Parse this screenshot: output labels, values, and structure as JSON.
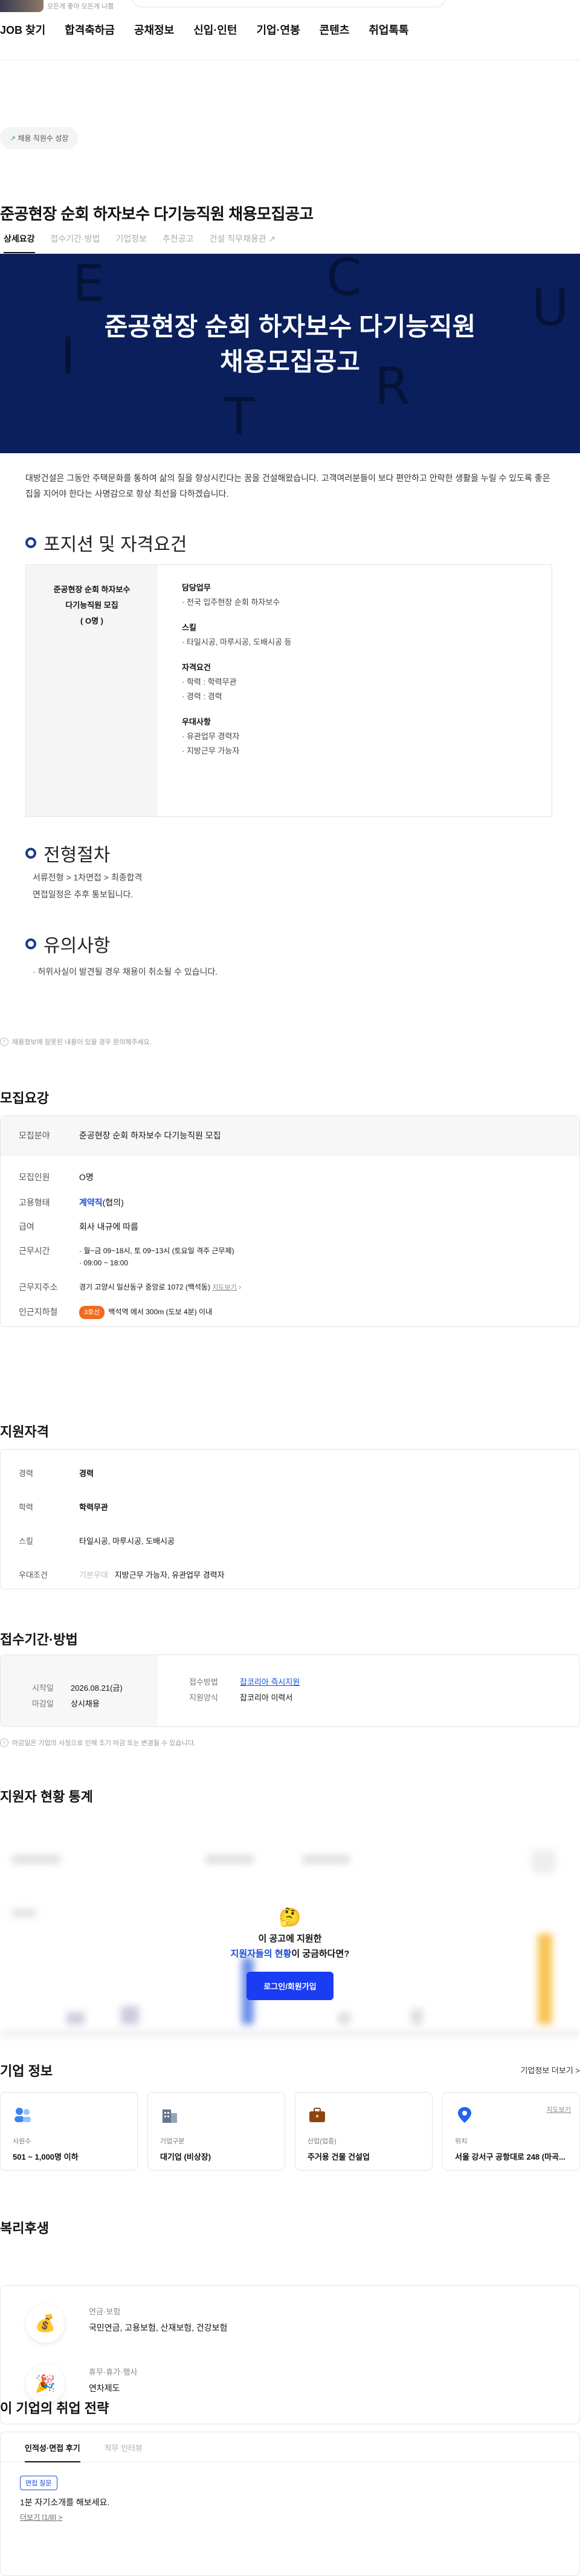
{
  "header": {
    "logo_caption": "모든게 좋아 모든게 나쁨",
    "nav": [
      "JOB 찾기",
      "합격축하금",
      "공채정보",
      "신입·인턴",
      "기업·연봉",
      "콘텐츠",
      "취업톡톡"
    ]
  },
  "badge": {
    "label": "채용 직원수 성장"
  },
  "job": {
    "title": "준공현장 순회 하자보수 다기능직원 채용모집공고",
    "tabs": [
      "상세요강",
      "접수기간·방법",
      "기업정보",
      "추천공고",
      "건설 직무채용관"
    ],
    "banner_title_line1": "준공현장 순회 하자보수 다기능직원",
    "banner_title_line2": "채용모집공고",
    "banner_letters": [
      "E",
      "C",
      "I",
      "R",
      "U",
      "T"
    ],
    "intro": "대방건설은 그동안 주택문화를 통하여 삶의 질을 향상시킨다는 꿈을 건설해왔습니다. 고객여러분들이 보다 편안하고 안락한 생활을 누릴 수 있도록 좋은 집을 지어야 한다는 사명감으로 항상 최선을 다하겠습니다."
  },
  "positions": {
    "heading": "포지션 및 자격요건",
    "left_title": "준공현장 순회 하자보수 다기능직원 모집",
    "left_count": "( O명 )",
    "duties_label": "담당업무",
    "duties": "· 전국 입주현장 순회 하자보수",
    "skills_label": "스킬",
    "skills": "· 타일시공, 마루시공, 도배시공 등",
    "req_label": "자격요건",
    "req": [
      "· 학력 : 학력무관",
      "· 경력 : 경력"
    ],
    "pref_label": "우대사항",
    "pref": [
      "· 유관업무 경력자",
      "· 지방근무 가능자"
    ]
  },
  "process": {
    "heading": "전형절차",
    "steps": "서류전형 > 1차면접 > 최종합격",
    "note": "면접일정은 추후 통보됩니다."
  },
  "caution": {
    "heading": "유의사항",
    "text": "· 허위사실이 발견될 경우 채용이 취소될 수 있습니다."
  },
  "report_note": "채용정보에 잘못된 내용이 있을 경우 문의해주세요.",
  "summary": {
    "heading": "모집요강",
    "field_label": "모집분야",
    "field": "준공현장 순회 하자보수 다기능직원 모집",
    "count_label": "모집인원",
    "count": "O명",
    "type_label": "고용형태",
    "type_value": "계약직",
    "type_suffix": "(협의)",
    "pay_label": "급여",
    "pay": "회사 내규에 따름",
    "hours_label": "근무시간",
    "hours1": "· 월~금 09~18시, 토 09~13시 (토요일 격주 근무제)",
    "hours2": "· 09:00 ~ 18:00",
    "addr_label": "근무지주소",
    "addr": "경기 고양시 일산동구 중앙로 1072 (백석동)",
    "addr_link": "지도보기",
    "subway_label": "인근지하철",
    "subway_line": "3호선",
    "subway": "백석역 에서 300m (도보 4분) 이내"
  },
  "qual": {
    "heading": "지원자격",
    "exp_label": "경력",
    "exp": "경력",
    "edu_label": "학력",
    "edu": "학력무관",
    "skill_label": "스킬",
    "skill": "타일시공, 마루시공, 도배시공",
    "pref_label": "우대조건",
    "pref_tag": "기본우대",
    "pref": "지방근무 가능자, 유관업무 경력자"
  },
  "apply": {
    "heading": "접수기간·방법",
    "start_label": "시작일",
    "start": "2026.08.21(금)",
    "end_label": "마감일",
    "end": "상시채용",
    "method_label": "접수방법",
    "method": "잡코리아 즉시지원",
    "form_label": "지원양식",
    "form": "잡코리아 이력서",
    "note": "마감일은 기업의 사정으로 인해 조기 마감 또는 변경될 수 있습니다."
  },
  "stats": {
    "heading": "지원자 현황 통계",
    "emoji": "🤔",
    "line1": "이 공고에 지원한",
    "line2_blue": "지원자들의 현황",
    "line2_rest": "이 궁금하다면?",
    "button": "로그인/회원가입"
  },
  "company": {
    "heading": "기업 정보",
    "more": "기업정보 더보기 >",
    "cards": [
      {
        "icon": "people-icon",
        "label": "사원수",
        "value": "501 ~ 1,000명 이하"
      },
      {
        "icon": "building-icon",
        "label": "기업구분",
        "value": "대기업 (비상장)"
      },
      {
        "icon": "briefcase-icon",
        "label": "산업(업종)",
        "value": "주거용 건물 건설업"
      },
      {
        "icon": "location-pin-icon",
        "label": "위치",
        "value": "서울 강서구 공항대로 248 (마곡...",
        "map": "지도보기"
      }
    ]
  },
  "welfare": {
    "heading": "복리후생",
    "rows": [
      {
        "icon": "💰",
        "title": "연금·보험",
        "text": "국민연금, 고용보험, 산재보험, 건강보험"
      },
      {
        "icon": "🎉",
        "title": "휴무·휴가·행사",
        "text": "연차제도"
      }
    ]
  },
  "strategy": {
    "heading": "이 기업의 취업 전략",
    "tabs": [
      "인적성·면접 후기",
      "직무 인터뷰"
    ],
    "tag": "면접 질문",
    "q": "1분 자기소개를 해보세요.",
    "link": "더보기 [1/8] >"
  }
}
